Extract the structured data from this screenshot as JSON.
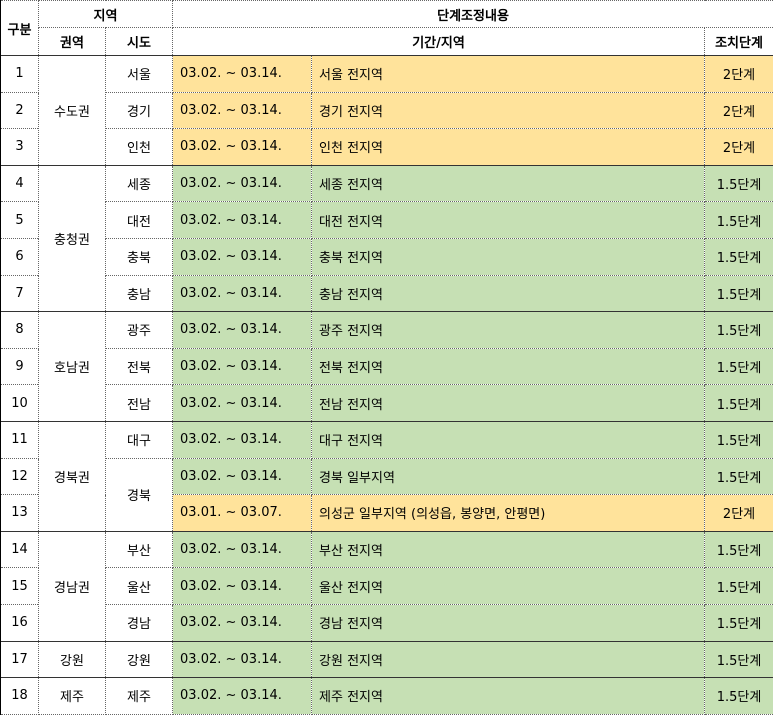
{
  "header": {
    "gubun": "구분",
    "region": "지역",
    "adjust": "단계조정내용",
    "area": "권역",
    "sido": "시도",
    "period_area": "기간/지역",
    "level": "조치단계"
  },
  "rows": [
    {
      "no": "1",
      "gwon": "수도권",
      "sido": "서울",
      "period": "03.02. ~ 03.14.",
      "area": "서울 전지역",
      "level": "2단계",
      "color": "#ffe39b"
    },
    {
      "no": "2",
      "sido": "경기",
      "period": "03.02. ~ 03.14.",
      "area": "경기 전지역",
      "level": "2단계",
      "color": "#ffe39b"
    },
    {
      "no": "3",
      "sido": "인천",
      "period": "03.02. ~ 03.14.",
      "area": "인천 전지역",
      "level": "2단계",
      "color": "#ffe39b"
    },
    {
      "no": "4",
      "gwon": "충청권",
      "sido": "세종",
      "period": "03.02. ~ 03.14.",
      "area": "세종 전지역",
      "level": "1.5단계",
      "color": "#c6e0b4"
    },
    {
      "no": "5",
      "sido": "대전",
      "period": "03.02. ~ 03.14.",
      "area": "대전 전지역",
      "level": "1.5단계",
      "color": "#c6e0b4"
    },
    {
      "no": "6",
      "sido": "충북",
      "period": "03.02. ~ 03.14.",
      "area": "충북 전지역",
      "level": "1.5단계",
      "color": "#c6e0b4"
    },
    {
      "no": "7",
      "sido": "충남",
      "period": "03.02. ~ 03.14.",
      "area": "충남 전지역",
      "level": "1.5단계",
      "color": "#c6e0b4"
    },
    {
      "no": "8",
      "gwon": "호남권",
      "sido": "광주",
      "period": "03.02. ~ 03.14.",
      "area": "광주 전지역",
      "level": "1.5단계",
      "color": "#c6e0b4"
    },
    {
      "no": "9",
      "sido": "전북",
      "period": "03.02. ~ 03.14.",
      "area": "전북 전지역",
      "level": "1.5단계",
      "color": "#c6e0b4"
    },
    {
      "no": "10",
      "sido": "전남",
      "period": "03.02. ~ 03.14.",
      "area": "전남 전지역",
      "level": "1.5단계",
      "color": "#c6e0b4"
    },
    {
      "no": "11",
      "gwon": "경북권",
      "sido": "대구",
      "period": "03.02. ~ 03.14.",
      "area": "대구 전지역",
      "level": "1.5단계",
      "color": "#c6e0b4"
    },
    {
      "no": "12",
      "sido": "경북",
      "period": "03.02. ~ 03.14.",
      "area": "경북 일부지역",
      "level": "1.5단계",
      "color": "#c6e0b4"
    },
    {
      "no": "13",
      "period": "03.01. ~ 03.07.",
      "area": "의성군 일부지역 (의성읍, 봉양면, 안평면)",
      "level": "2단계",
      "color": "#ffe39b"
    },
    {
      "no": "14",
      "gwon": "경남권",
      "sido": "부산",
      "period": "03.02. ~ 03.14.",
      "area": "부산 전지역",
      "level": "1.5단계",
      "color": "#c6e0b4"
    },
    {
      "no": "15",
      "sido": "울산",
      "period": "03.02. ~ 03.14.",
      "area": "울산 전지역",
      "level": "1.5단계",
      "color": "#c6e0b4"
    },
    {
      "no": "16",
      "sido": "경남",
      "period": "03.02. ~ 03.14.",
      "area": "경남 전지역",
      "level": "1.5단계",
      "color": "#c6e0b4"
    },
    {
      "no": "17",
      "gwon": "강원",
      "sido": "강원",
      "period": "03.02. ~ 03.14.",
      "area": "강원 전지역",
      "level": "1.5단계",
      "color": "#c6e0b4"
    },
    {
      "no": "18",
      "gwon": "제주",
      "sido": "제주",
      "period": "03.02. ~ 03.14.",
      "area": "제주 전지역",
      "level": "1.5단계",
      "color": "#c6e0b4"
    }
  ]
}
